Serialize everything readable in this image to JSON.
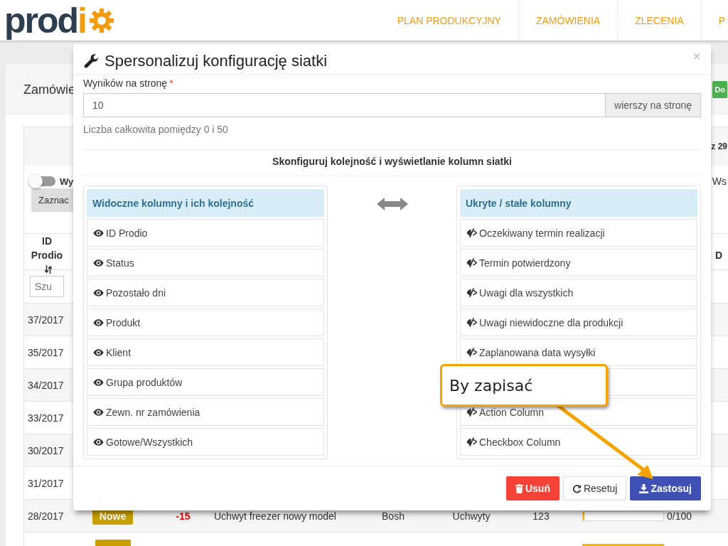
{
  "logo": {
    "text": "prod",
    "accent": "i"
  },
  "nav": [
    {
      "label": "PLAN PRODUKCYJNY"
    },
    {
      "label": "ZAMÓWIENIA"
    },
    {
      "label": "ZLECENIA"
    },
    {
      "label": "P"
    }
  ],
  "page": {
    "title": "Zamówie",
    "add_button": "Do",
    "count_text": "z 29",
    "toggle_label": "Wy",
    "toggle_on": false,
    "select_button": "Zaznac",
    "columns_label": "Ws"
  },
  "table": {
    "columns": [
      {
        "label": "ID Prodio",
        "sortable": true
      },
      {
        "label": "D",
        "sortable": false
      }
    ],
    "search_placeholder": "Szu",
    "rows": [
      {
        "id": "37/2017"
      },
      {
        "id": "35/2017"
      },
      {
        "id": "34/2017"
      },
      {
        "id": "33/2017"
      },
      {
        "id": "30/2017"
      },
      {
        "id": "31/2017"
      },
      {
        "id": "28/2017",
        "status": "Nowe",
        "days": "-15",
        "product": "Uchwyt freezer nowy model",
        "client": "Bosh",
        "group": "Uchwyty",
        "qty": "123",
        "progress": "0/100",
        "level": 0
      },
      {
        "status_badge": true,
        "level": 1
      }
    ]
  },
  "modal": {
    "title": "Spersonalizuj konfigurację siatki",
    "close": "×",
    "per_page_label": "Wyników na stronę",
    "required_mark": "*",
    "per_page_value": "10",
    "per_page_addon": "wierszy na stronę",
    "help": "Liczba całkowita pomiędzy 0 i 50",
    "section_heading": "Skonfiguruj kolejność i wyświetlanie kolumn siatki",
    "visible_panel": {
      "title": "Widoczne kolumny i ich kolejność",
      "items": [
        {
          "label": "ID Prodio"
        },
        {
          "label": "Status"
        },
        {
          "label": "Pozostało dni"
        },
        {
          "label": "Produkt"
        },
        {
          "label": "Klient"
        },
        {
          "label": "Grupa produktów"
        },
        {
          "label": "Zewn. nr zamówienia"
        },
        {
          "label": "Gotowe/Wszystkich"
        }
      ]
    },
    "hidden_panel": {
      "title": "Ukryte / stałe kolumny",
      "items": [
        {
          "label": "Oczekiwany termin realizacji"
        },
        {
          "label": "Termin potwierdzony"
        },
        {
          "label": "Uwagi dla wszystkich"
        },
        {
          "label": "Uwagi niewidoczne dla produkcji"
        },
        {
          "label": "Zaplanowana data wysyłki"
        },
        {
          "kind": "covered"
        },
        {
          "label": "Action Column"
        },
        {
          "label": "Checkbox Column"
        }
      ]
    },
    "buttons": [
      {
        "kind": "delete",
        "label": "Usuń"
      },
      {
        "kind": "reset",
        "label": "Resetuj"
      },
      {
        "kind": "apply",
        "label": "Zastosuj"
      }
    ]
  },
  "callout": {
    "text": "By zapisać"
  }
}
